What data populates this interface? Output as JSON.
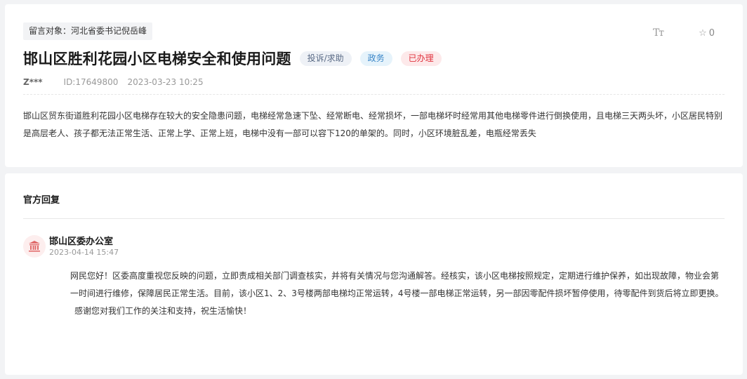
{
  "message": {
    "target_label": "留言对象：河北省委书记倪岳峰",
    "font_size_icon": "font-size-icon",
    "font_size_glyph": "Tт",
    "favorite_icon": "star-icon",
    "favorite_glyph": "☆",
    "favorite_count": "0",
    "title": "邯山区胜利花园小区电梯安全和使用问题",
    "badges": {
      "category": "投诉/求助",
      "field": "政务",
      "status": "已办理"
    },
    "user": "Z***",
    "id_text": "ID:17649800",
    "datetime": "2023-03-23 10:25",
    "content": "邯山区贸东街道胜利花园小区电梯存在较大的安全隐患问题，电梯经常急速下坠、经常断电、经常损坏，一部电梯坏时经常用其他电梯零件进行倒换使用，且电梯三天两头坏，小区居民特别是高层老人、孩子都无法正常生活、正常上学、正常上班，电梯中没有一部可以容下120的单架的。同时，小区环境脏乱差，电瓶经常丢失"
  },
  "reply": {
    "section_title": "官方回复",
    "avatar_icon": "government-building-icon",
    "org_name": "邯山区委办公室",
    "datetime": "2023-04-14 15:47",
    "paragraph1": "网民您好！区委高度重视您反映的问题，立即责成相关部门调查核实，并将有关情况与您沟通解答。经核实，该小区电梯按照规定，定期进行维护保养，如出现故障，物业会第一时间进行维修，保障居民正常生活。目前，该小区1、2、3号楼两部电梯均正常运转，4号楼一部电梯正常运转，另一部因零配件损坏暂停使用，待零配件到货后将立即更换。",
    "paragraph2": "感谢您对我们工作的关注和支持，祝生活愉快！"
  },
  "colors": {
    "status_red": "#e0343f",
    "field_blue": "#3a86c8",
    "avatar_red": "#e06a6a",
    "page_bg": "#f2f3f5"
  }
}
